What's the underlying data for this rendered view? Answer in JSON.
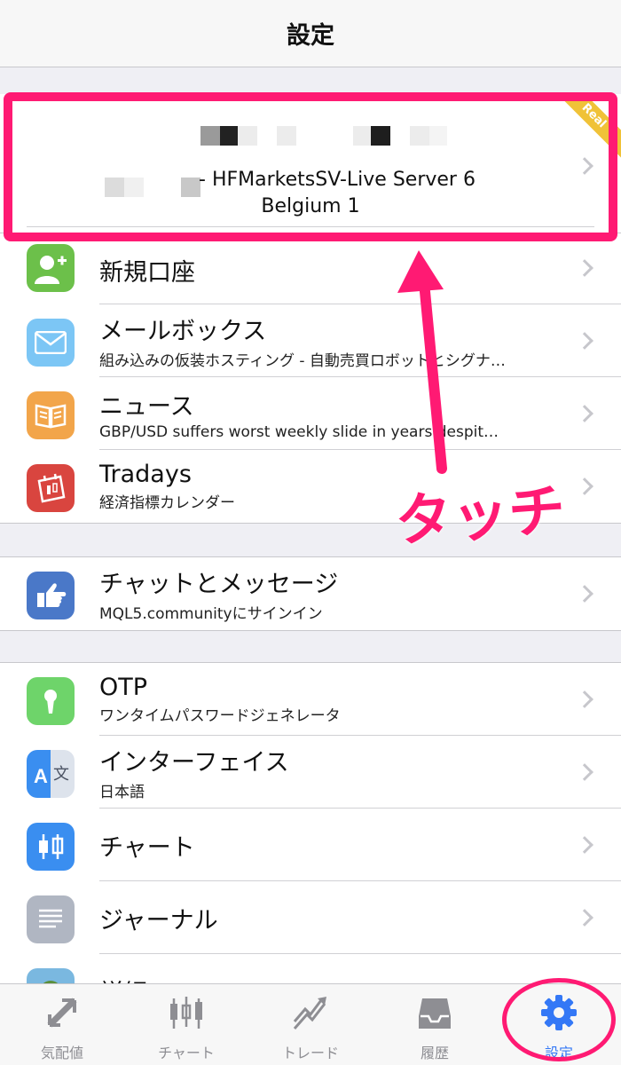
{
  "nav": {
    "title": "設定"
  },
  "account": {
    "server_line1": "- HFMarketsSV-Live Server 6",
    "server_line2": "Belgium 1",
    "ribbon": "Real"
  },
  "groups": [
    {
      "items": [
        {
          "icon": "add-account-icon",
          "color": "#6cc04a",
          "label": "新規口座",
          "sub": ""
        },
        {
          "icon": "mail-icon",
          "color": "#7cc6f5",
          "label": "メールボックス",
          "sub": "組み込みの仮装ホスティング - 自動売買ロボットとシグナ…"
        },
        {
          "icon": "news-book-icon",
          "color": "#f2a54a",
          "label": "ニュース",
          "sub": "GBP/USD suffers worst weekly slide in years despit…"
        },
        {
          "icon": "calendar-icon",
          "color": "#d9453f",
          "label": "Tradays",
          "sub": "経済指標カレンダー"
        }
      ]
    },
    {
      "items": [
        {
          "icon": "chat-hand-icon",
          "color": "#4a78c8",
          "label": "チャットとメッセージ",
          "sub": "MQL5.communityにサインイン"
        }
      ]
    },
    {
      "items": [
        {
          "icon": "keyhole-icon",
          "color": "#6ed46a",
          "label": "OTP",
          "sub": "ワンタイムパスワードジェネレータ"
        },
        {
          "icon": "translate-icon",
          "color": "#3a8ef0",
          "label": "インターフェイス",
          "sub": "日本語"
        },
        {
          "icon": "candlestick-icon",
          "color": "#3a8ef0",
          "label": "チャート",
          "sub": ""
        },
        {
          "icon": "journal-icon",
          "color": "#b0b6c2",
          "label": "ジャーナル",
          "sub": ""
        },
        {
          "icon": "about-icon",
          "color": "#7ab8e0",
          "label": "詳細",
          "sub": ""
        }
      ]
    }
  ],
  "annotation": {
    "text": "タッチ",
    "color": "#ff1a73"
  },
  "tabs": [
    {
      "icon": "quotes-icon",
      "label": "気配値"
    },
    {
      "icon": "chart-tab-icon",
      "label": "チャート"
    },
    {
      "icon": "trade-icon",
      "label": "トレード"
    },
    {
      "icon": "history-inbox-icon",
      "label": "履歴"
    },
    {
      "icon": "settings-gear-icon",
      "label": "設定",
      "active": true
    }
  ],
  "colors": {
    "accent": "#3478f6",
    "highlight": "#ff1a73"
  }
}
